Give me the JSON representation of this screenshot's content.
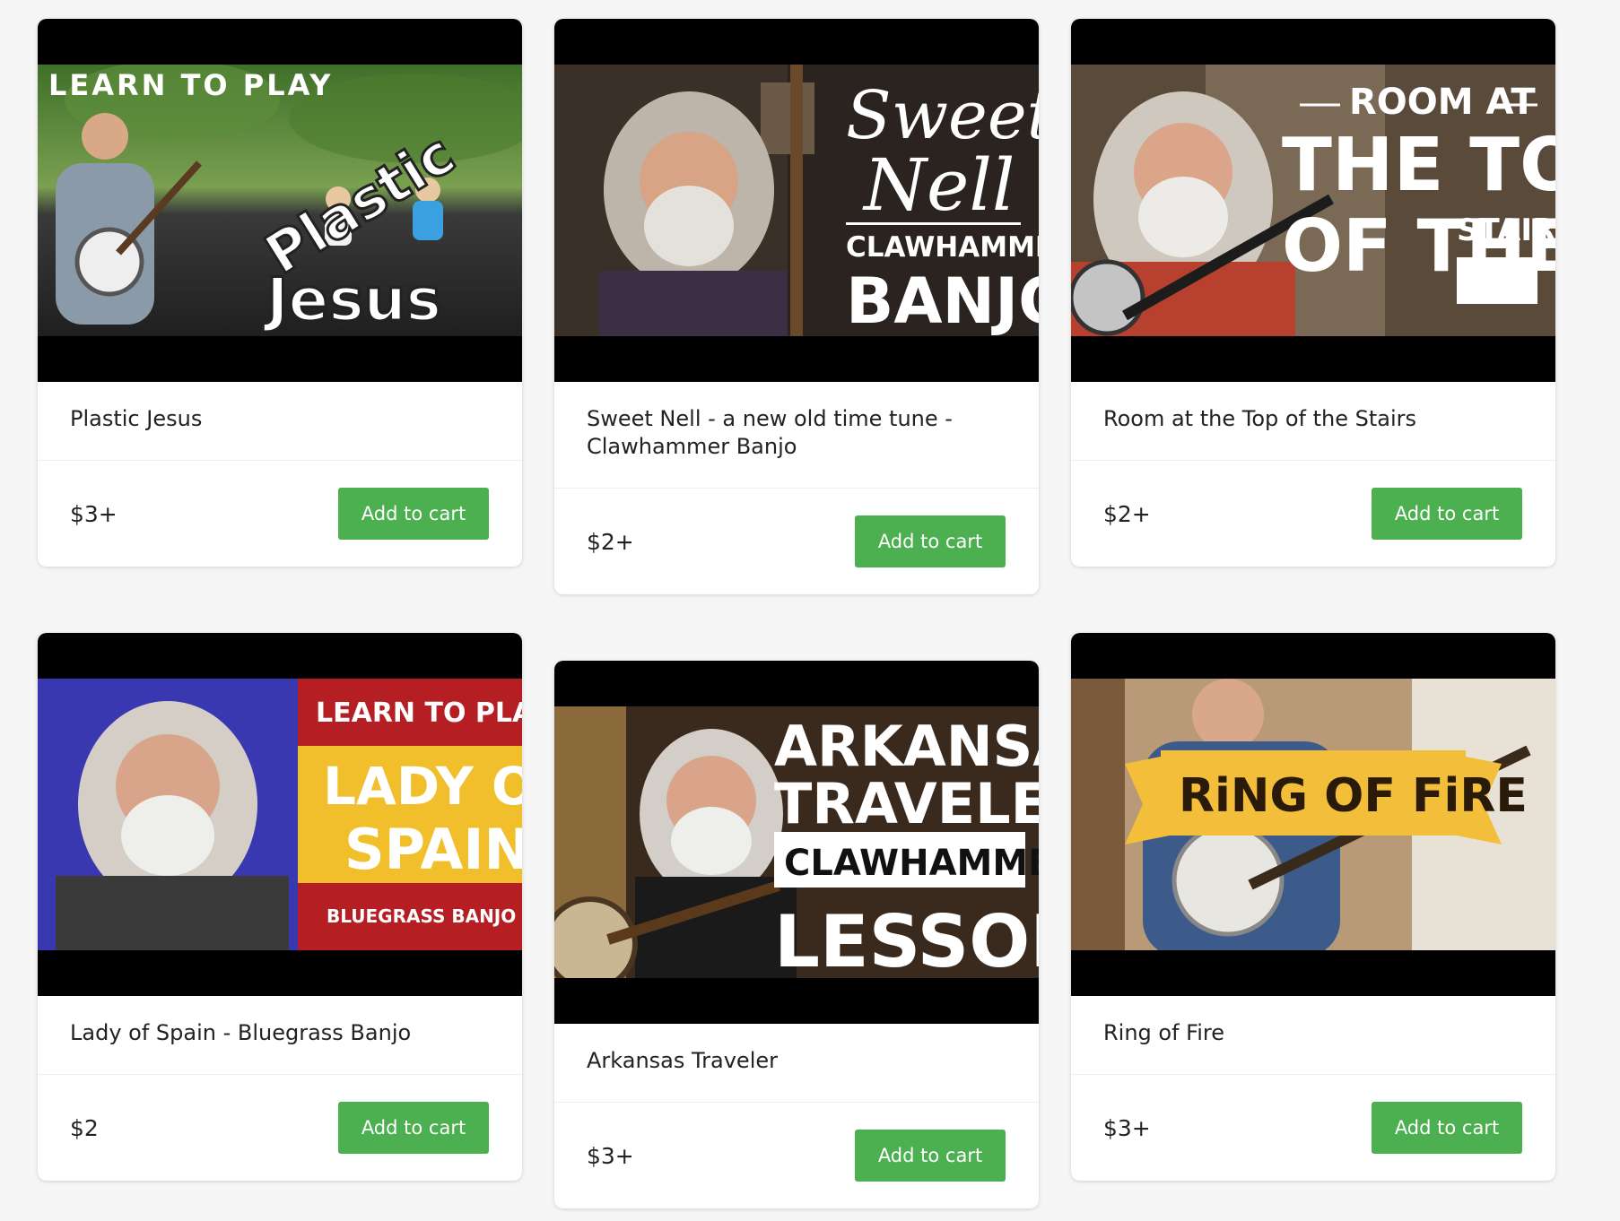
{
  "products": [
    {
      "title": "Plastic Jesus",
      "price": "$3+",
      "button_label": "Add to cart",
      "thumb_text": {
        "line1": "LEARN TO PLAY",
        "line2": "Plastic",
        "line3": "Jesus"
      }
    },
    {
      "title": "Sweet Nell - a new old time tune - Clawhammer Banjo",
      "price": "$2+",
      "button_label": "Add to cart",
      "thumb_text": {
        "line1": "Sweet",
        "line2": "Nell",
        "line3": "CLAWHAMMER",
        "line4": "BANJO"
      }
    },
    {
      "title": "Room at the Top of the Stairs",
      "price": "$2+",
      "button_label": "Add to cart",
      "thumb_text": {
        "line1": "ROOM AT",
        "line2": "THE TOP",
        "line3": "OF THE",
        "line4": "STAIRS"
      }
    },
    {
      "title": "Lady of Spain - Bluegrass Banjo",
      "price": "$2",
      "button_label": "Add to cart",
      "thumb_text": {
        "line1": "LEARN TO PLAY",
        "line2": "LADY OF",
        "line3": "SPAIN",
        "line4": "BLUEGRASS BANJO"
      }
    },
    {
      "title": "Arkansas Traveler",
      "price": "$3+",
      "button_label": "Add to cart",
      "thumb_text": {
        "line1": "ARKANSAS",
        "line2": "TRAVELER",
        "line3": "CLAWHAMMER",
        "line4": "LESSON"
      }
    },
    {
      "title": "Ring of Fire",
      "price": "$3+",
      "button_label": "Add to cart",
      "thumb_text": {
        "line1": "RiNG OF FiRE"
      }
    }
  ],
  "colors": {
    "button": "#4caf50",
    "background": "#f5f5f5"
  }
}
